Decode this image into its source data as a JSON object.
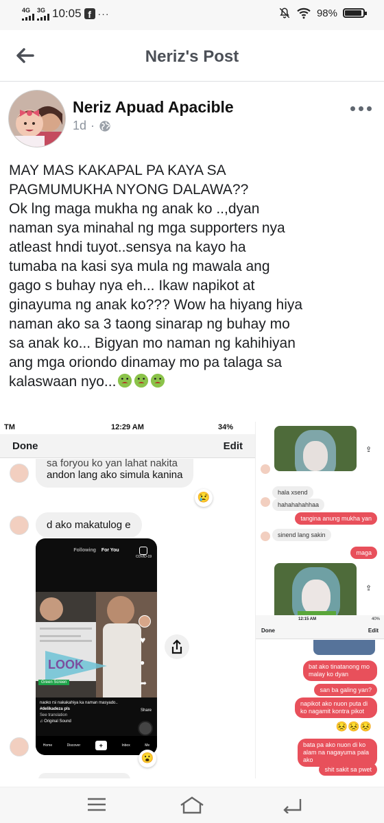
{
  "status_bar": {
    "network_1": "4G",
    "network_2": "3G",
    "time": "10:05",
    "app_icon": "f",
    "more": "···",
    "battery_percent": "98%",
    "battery_level": 0.98,
    "icons": [
      "mute-icon",
      "wifi-icon",
      "battery-icon"
    ]
  },
  "header": {
    "title": "Neriz's Post",
    "back_icon": "arrow-left-icon"
  },
  "post": {
    "author": "Neriz Apuad Apacible",
    "time_ago": "1d",
    "separator": "·",
    "privacy_icon": "globe-icon",
    "text_lines": [
      "MAY MAS KAKAPAL PA KAYA SA",
      "PAGMUMUKHA NYONG DALAWA??",
      "Ok lng maga mukha ng anak ko ..,dyan",
      "naman sya minahal ng mga supporters nya",
      "atleast hndi tuyot..sensya na kayo ha",
      "tumaba na kasi sya mula ng mawala ang",
      "gago s buhay nya eh... Ikaw napikot at",
      "ginayuma ng anak ko??? Wow ha hiyang hiya",
      "naman ako sa 3 taong sinarap ng buhay mo",
      "sa anak ko... Bigyan mo naman ng kahihiyan",
      "ang mga oriondo dinamay mo pa talaga sa",
      "kalaswaan nyo..."
    ],
    "emoji_count": 3
  },
  "screenshot_left": {
    "status": {
      "carrier": "TM",
      "time": "12:29 AM",
      "battery": "34%"
    },
    "nav": {
      "left": "Done",
      "right": "Edit"
    },
    "messages": [
      "sa foryou ko yan lahat nakita",
      "andon lang ako simula kanina",
      "d ako makatulog e"
    ],
    "tiktok": {
      "tab_following": "Following",
      "tab_for_you": "For You",
      "covid": "COVID-19",
      "look_label": "LOOK",
      "green_screen": "Green Screen",
      "caption_1": "naoko rsi nakakahiya ka naman masyado..",
      "hashtag": "#delikadeza pls",
      "see_translation": "See translation",
      "sound": "Original Sound",
      "share": "Share",
      "nav": [
        "Home",
        "Discover",
        "+",
        "Inbox",
        "Me"
      ]
    }
  },
  "screenshot_right": {
    "messages_left": [
      "hala xsend",
      "hahahahahhaa",
      "sinend lang sakin"
    ],
    "messages_right": [
      "tangina anung mukha yan",
      "maga"
    ],
    "inner_status": {
      "time": "12:15 AM",
      "battery": "40%"
    },
    "inner_nav": {
      "left": "Done",
      "right": "Edit"
    },
    "messages_right_2": [
      "bat ako tinatanong mo malay ko dyan",
      "san ba galing yan?",
      "napikot ako nuon puta di ko nagamit kontra pikot",
      "bata pa ako nuon di ko alam na nagayuma pala ako",
      "shit sakit sa pwet"
    ],
    "emoji_row": "😣😣😣"
  },
  "bottom_nav": {
    "icons": [
      "menu-icon",
      "home-icon",
      "back-icon"
    ]
  }
}
